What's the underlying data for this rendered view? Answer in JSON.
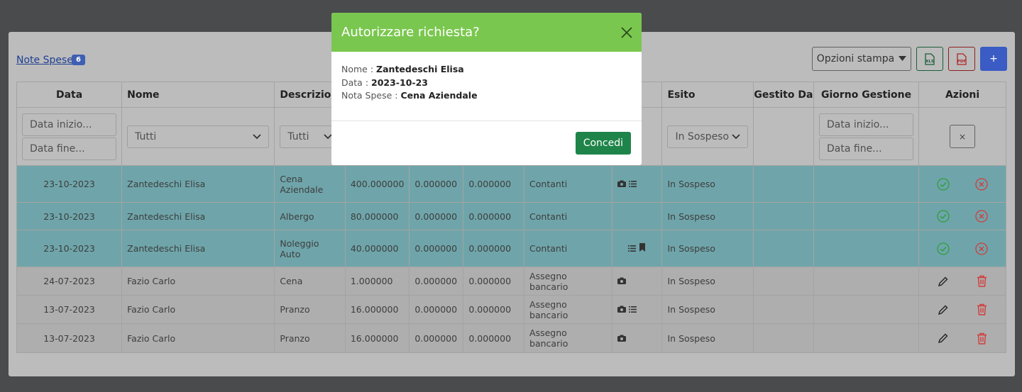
{
  "header": {
    "link": "Note Spese",
    "badge": "6"
  },
  "toolbar": {
    "print_options": "Opzioni stampa",
    "xls": "XLS",
    "pdf": "PDF",
    "add": "+"
  },
  "table": {
    "headers": [
      "Data",
      "Nome",
      "Descrizione",
      "",
      "",
      "",
      "",
      "",
      "Esito",
      "Gestito Da",
      "Giorno Gestione",
      "Azioni"
    ],
    "filters": {
      "date_start_ph": "Data inizio...",
      "date_end_ph": "Data fine...",
      "nome": "Tutti",
      "descr": "Tutti",
      "esito": "In Sospeso",
      "gg_start_ph": "Data inizio...",
      "gg_end_ph": "Data fine...",
      "clear": "×"
    },
    "rows": [
      {
        "data": "23-10-2023",
        "nome": "Zantedeschi Elisa",
        "descr": "Cena Aziendale",
        "importo": "400.000000",
        "v2": "0.000000",
        "v3": "0.000000",
        "pagamento": "Contanti",
        "esito": "In Sospeso"
      },
      {
        "data": "23-10-2023",
        "nome": "Zantedeschi Elisa",
        "descr": "Albergo",
        "importo": "80.000000",
        "v2": "0.000000",
        "v3": "0.000000",
        "pagamento": "Contanti",
        "esito": "In Sospeso"
      },
      {
        "data": "23-10-2023",
        "nome": "Zantedeschi Elisa",
        "descr": "Noleggio Auto",
        "importo": "40.000000",
        "v2": "0.000000",
        "v3": "0.000000",
        "pagamento": "Contanti",
        "esito": "In Sospeso"
      },
      {
        "data": "24-07-2023",
        "nome": "Fazio Carlo",
        "descr": "Cena",
        "importo": "1.000000",
        "v2": "0.000000",
        "v3": "0.000000",
        "pagamento": "Assegno bancario",
        "esito": "In Sospeso"
      },
      {
        "data": "13-07-2023",
        "nome": "Fazio Carlo",
        "descr": "Pranzo",
        "importo": "16.000000",
        "v2": "0.000000",
        "v3": "0.000000",
        "pagamento": "Assegno bancario",
        "esito": "In Sospeso"
      },
      {
        "data": "13-07-2023",
        "nome": "Fazio Carlo",
        "descr": "Pranzo",
        "importo": "16.000000",
        "v2": "0.000000",
        "v3": "0.000000",
        "pagamento": "Assegno bancario",
        "esito": "In Sospeso"
      }
    ]
  },
  "modal": {
    "title": "Autorizzare richiesta?",
    "nome_label": "Nome :",
    "nome": "Zantedeschi Elisa",
    "data_label": "Data :",
    "data": "2023-10-23",
    "nota_label": "Nota Spese :",
    "nota": "Cena Aziendale",
    "confirm": "Concedi"
  },
  "colors": {
    "modal_header": "#7ac74f",
    "concedi": "#1e8449",
    "approve": "#2e9e3e",
    "reject": "#d23b3b",
    "highlight_row": "#6fa5aa"
  },
  "icons": [
    "close-icon",
    "caret-down-icon",
    "excel-file-icon",
    "pdf-file-icon",
    "chevron-down-icon",
    "camera-icon",
    "list-icon",
    "bookmark-icon",
    "check-circle-icon",
    "x-circle-icon",
    "pencil-icon",
    "trash-icon"
  ]
}
